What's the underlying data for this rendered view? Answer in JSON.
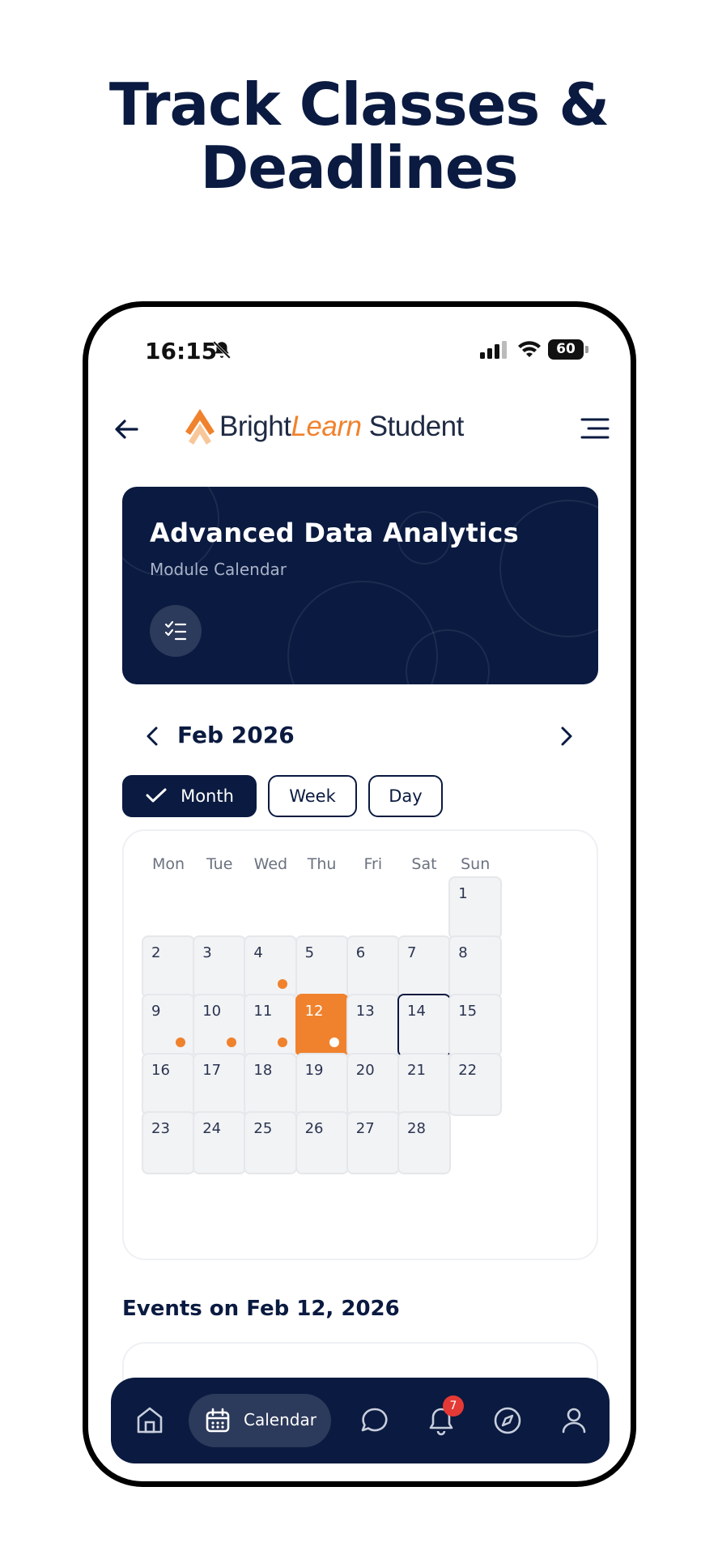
{
  "promo": {
    "title_line1": "Track Classes &",
    "title_line2": "Deadlines"
  },
  "status_bar": {
    "time": "16:15",
    "battery": "60",
    "icons": [
      "bell-slash-icon",
      "signal-icon",
      "wifi-icon",
      "battery-icon"
    ]
  },
  "app_bar": {
    "brand_bright": "Bright",
    "brand_learn": "Learn",
    "brand_student": " Student",
    "icons": [
      "back-arrow-icon",
      "logo-mark-icon",
      "menu-icon"
    ]
  },
  "hero": {
    "title": "Advanced Data Analytics",
    "subtitle": "Module Calendar",
    "icon": "checklist-icon"
  },
  "calendar_nav": {
    "month_label": "Feb 2026",
    "icons": [
      "chevron-left-icon",
      "chevron-right-icon"
    ]
  },
  "view_toggle": {
    "month": "Month",
    "week": "Week",
    "day": "Day",
    "active": "Month"
  },
  "calendar": {
    "weekdays": [
      "Mon",
      "Tue",
      "Wed",
      "Thu",
      "Fri",
      "Sat",
      "Sun"
    ],
    "first_weekday_index": 6,
    "days_in_month": 28,
    "selected_day": 12,
    "today_day": 14,
    "days_with_events": [
      4,
      9,
      10,
      11,
      12
    ],
    "accent_color": "#f0822d",
    "primary_color": "#0a1a40"
  },
  "events": {
    "heading": "Events on Feb 12, 2026"
  },
  "bottom_nav": {
    "active_label": "Calendar",
    "notification_count": "7",
    "icons": [
      "home-icon",
      "calendar-icon",
      "chat-icon",
      "bell-icon",
      "compass-icon",
      "profile-icon"
    ]
  }
}
